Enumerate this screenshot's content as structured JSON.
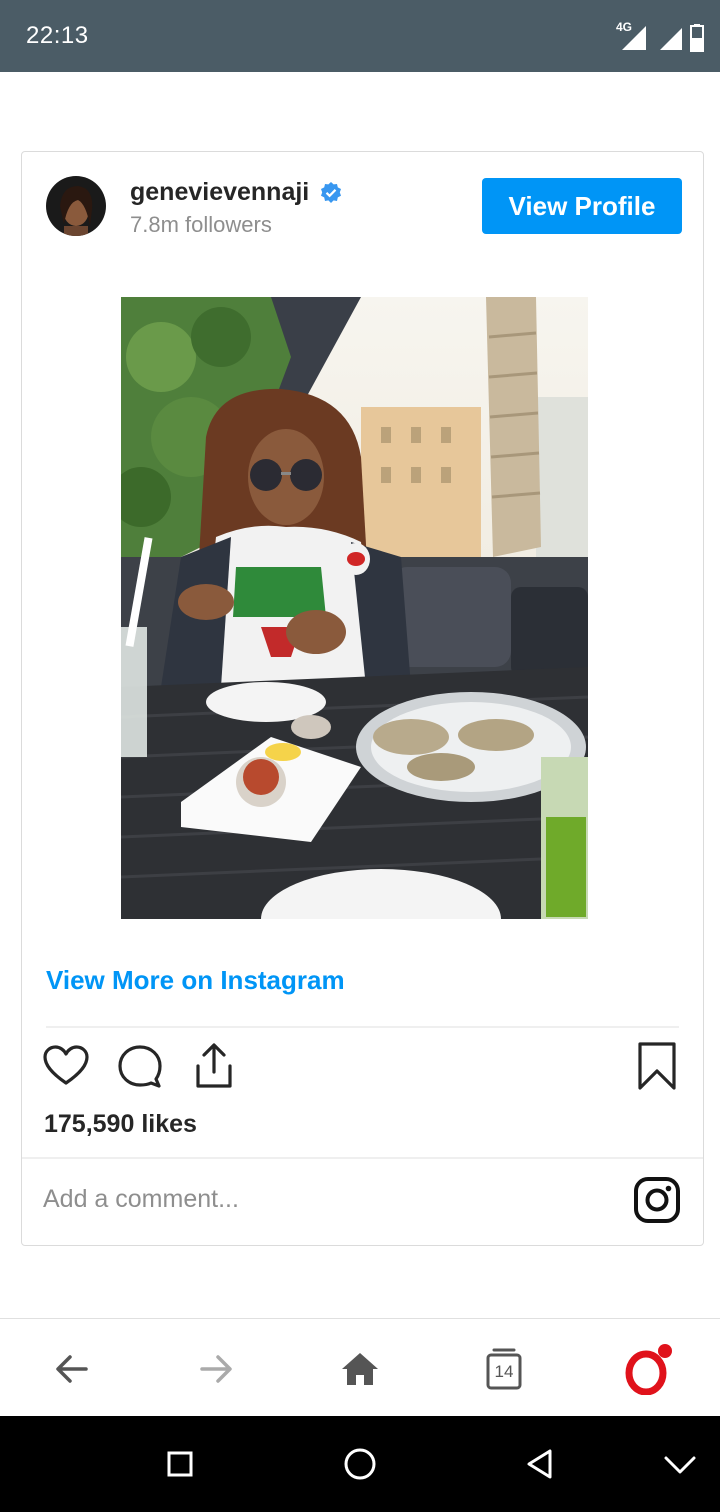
{
  "status_bar": {
    "time": "22:13",
    "network": "4G",
    "icons": [
      "signal-icon",
      "signal-icon",
      "battery-icon"
    ]
  },
  "post": {
    "username": "genevievennaji",
    "verified": true,
    "followers": "7.8m followers",
    "view_profile_label": "View Profile",
    "view_more_label": "View More on Instagram",
    "likes": "175,590 likes",
    "comment_placeholder": "Add a comment...",
    "action_icons": [
      "heart-icon",
      "comment-icon",
      "share-icon",
      "bookmark-icon"
    ]
  },
  "browser_toolbar": {
    "tab_count": "14",
    "buttons": [
      "back-icon",
      "forward-icon",
      "home-icon",
      "tabs-icon",
      "opera-menu-icon"
    ]
  },
  "system_nav": {
    "buttons": [
      "recents-icon",
      "home-circle-icon",
      "back-triangle-icon",
      "collapse-icon"
    ]
  },
  "colors": {
    "status_bar": "#4b5c66",
    "accent": "#0095f6",
    "opera_red": "#e0121b"
  }
}
